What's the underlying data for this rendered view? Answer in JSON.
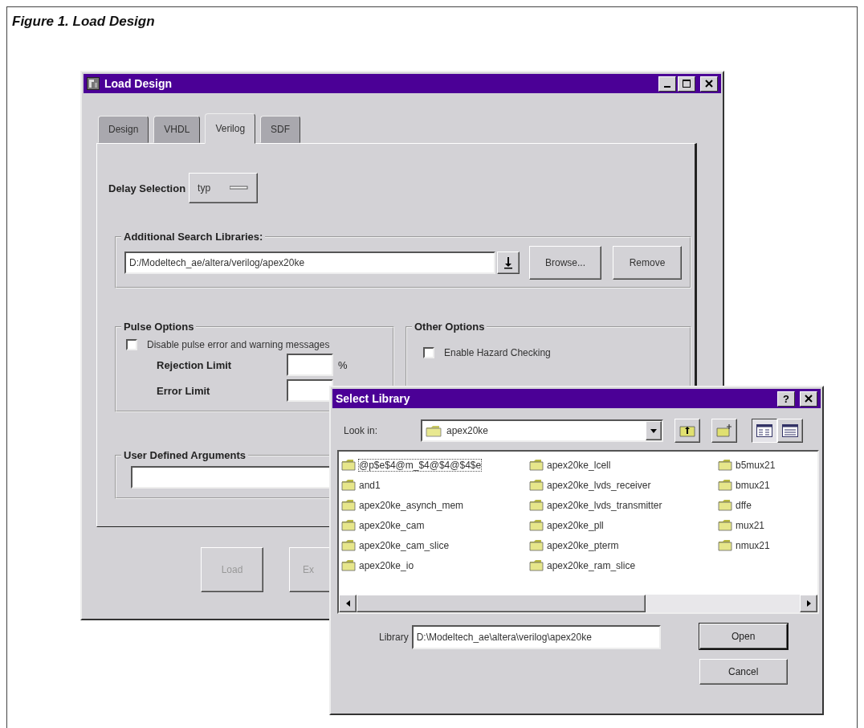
{
  "figure": {
    "caption": "Figure 1. Load Design"
  },
  "load_design": {
    "title": "Load Design",
    "tabs": [
      {
        "label": "Design",
        "selected": false
      },
      {
        "label": "VHDL",
        "selected": false
      },
      {
        "label": "Verilog",
        "selected": true
      },
      {
        "label": "SDF",
        "selected": false
      }
    ],
    "delay_selection": {
      "label": "Delay Selection",
      "value": "typ"
    },
    "additional_search_libraries": {
      "label": "Additional Search Libraries:",
      "path": "D:/Modeltech_ae/altera/verilog/apex20ke",
      "buttons": [
        "Browse...",
        "Remove"
      ]
    },
    "pulse_options": {
      "label": "Pulse Options",
      "checkbox": {
        "label": "Disable pulse error and warning messages",
        "checked": false
      },
      "rejection_limit": {
        "label": "Rejection Limit",
        "unit": "%"
      },
      "error_limit": {
        "label": "Error Limit"
      }
    },
    "other_options": {
      "label": "Other Options",
      "checkbox": {
        "label": "Enable Hazard Checking",
        "checked": false
      }
    },
    "user_defined_arguments": {
      "label": "User Defined Arguments"
    },
    "buttons": [
      {
        "label": "Load",
        "disabled": true
      },
      {
        "label": "Ex",
        "disabled": true
      }
    ]
  },
  "select_library": {
    "title": "Select Library",
    "help_button": "?",
    "look_in": {
      "label": "Look in:",
      "value": "apex20ke"
    },
    "files": [
      {
        "name": "@p$e$4@m_$4@$4@$4$e",
        "focused": true
      },
      {
        "name": "and1",
        "focused": false
      },
      {
        "name": "apex20ke_asynch_mem",
        "focused": false
      },
      {
        "name": "apex20ke_cam",
        "focused": false
      },
      {
        "name": "apex20ke_cam_slice",
        "focused": false
      },
      {
        "name": "apex20ke_io",
        "focused": false
      },
      {
        "name": "apex20ke_lcell",
        "focused": false
      },
      {
        "name": "apex20ke_lvds_receiver",
        "focused": false
      },
      {
        "name": "apex20ke_lvds_transmitter",
        "focused": false
      },
      {
        "name": "apex20ke_pll",
        "focused": false
      },
      {
        "name": "apex20ke_pterm",
        "focused": false
      },
      {
        "name": "apex20ke_ram_slice",
        "focused": false
      },
      {
        "name": "b5mux21",
        "focused": false
      },
      {
        "name": "bmux21",
        "focused": false
      },
      {
        "name": "dffe",
        "focused": false
      },
      {
        "name": "mux21",
        "focused": false
      },
      {
        "name": "nmux21",
        "focused": false
      }
    ],
    "library": {
      "label": "Library",
      "value": "D:\\Modeltech_ae\\altera\\verilog\\apex20ke"
    },
    "buttons": [
      "Open",
      "Cancel"
    ]
  }
}
